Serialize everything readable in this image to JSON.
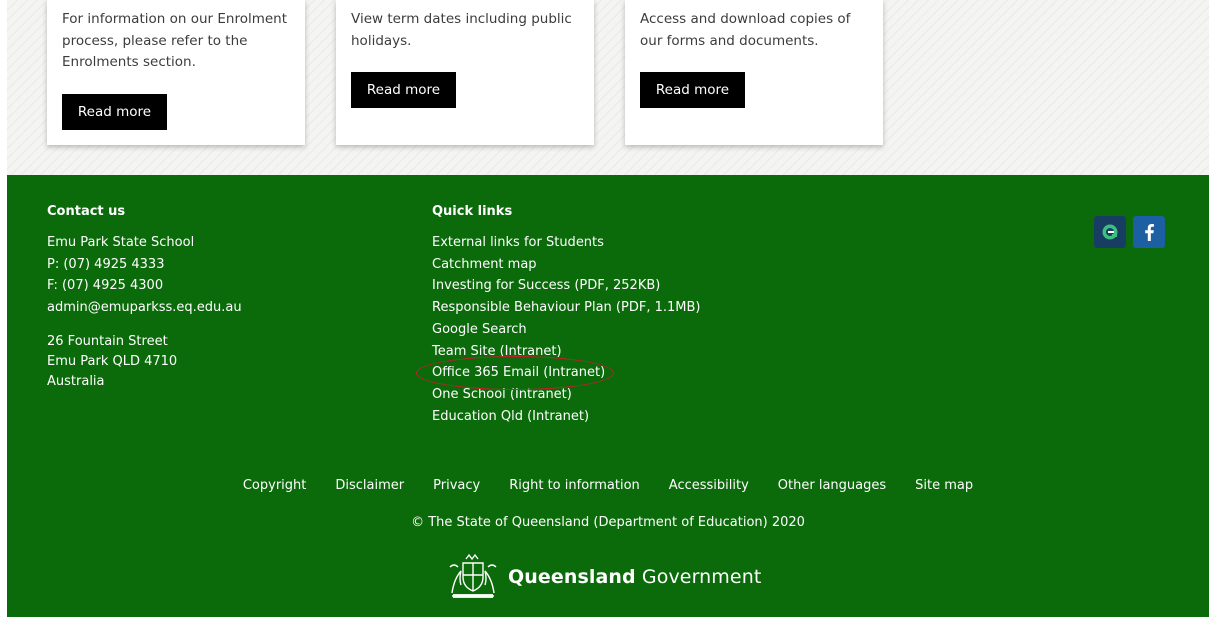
{
  "cards": [
    {
      "text": "For information on our Enrolment process, please refer to the Enrolments section.",
      "button": "Read more"
    },
    {
      "text": "View term dates including public holidays.",
      "button": "Read more"
    },
    {
      "text": "Access and download copies of our forms and documents.",
      "button": "Read more"
    }
  ],
  "contact": {
    "title": "Contact us",
    "name": "Emu Park State School",
    "phone": "P: (07) 4925 4333",
    "fax": "F: (07) 4925 4300",
    "email": "admin@emuparkss.eq.edu.au",
    "street": "26 Fountain Street",
    "suburb": "Emu Park QLD 4710",
    "country": "Australia"
  },
  "quick_links": {
    "title": "Quick links",
    "items": [
      "External links for Students",
      "Catchment map",
      "Investing for Success (PDF, 252KB)",
      "Responsible Behaviour Plan (PDF, 1.1MB)",
      "Google Search",
      "Team Site (Intranet)",
      "Office 365 Email (Intranet)",
      "One School (Intranet)",
      "Education Qld (Intranet)"
    ]
  },
  "social": [
    {
      "icon": "qschools-app-icon",
      "color": "#173d63"
    },
    {
      "icon": "facebook-icon",
      "color": "#1d5fa3"
    }
  ],
  "footer_links": [
    "Copyright",
    "Disclaimer",
    "Privacy",
    "Right to information",
    "Accessibility",
    "Other languages",
    "Site map"
  ],
  "copyright": "© The State of Queensland (Department of Education) 2020",
  "logo": {
    "bold": "Queensland",
    "regular": "Government"
  },
  "colors": {
    "footer_bg": "#0b6b0b",
    "highlight": "#c0202a"
  }
}
